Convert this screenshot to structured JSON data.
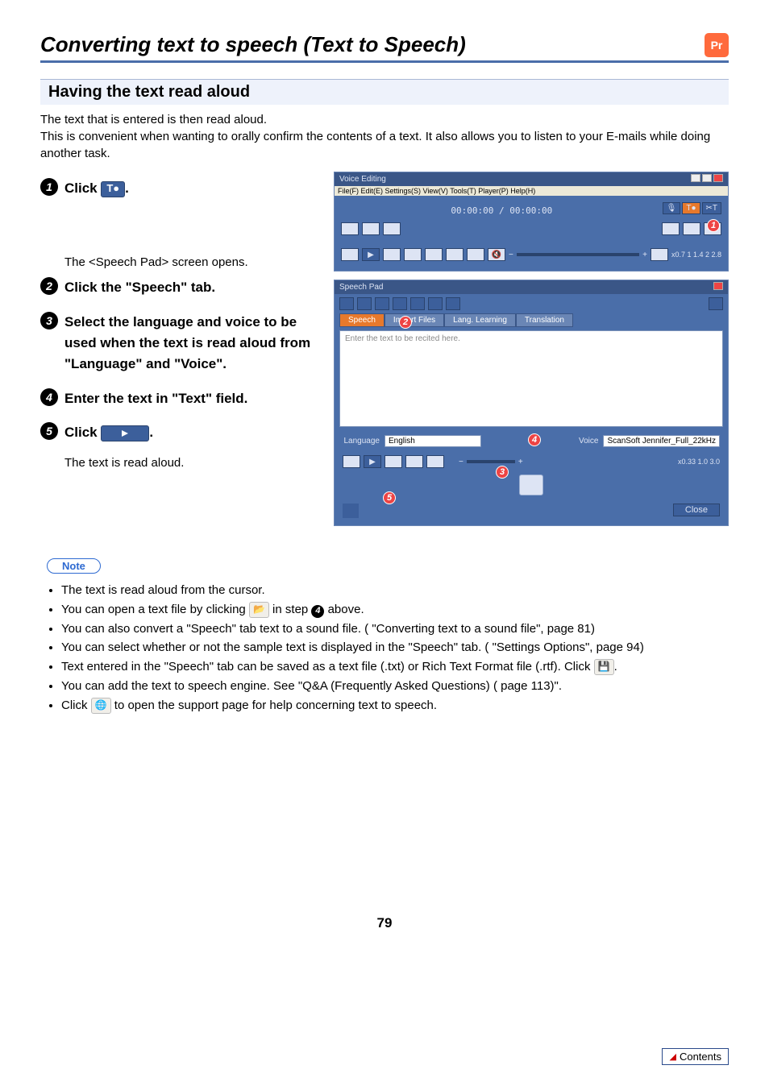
{
  "title": "Converting text to speech (Text to Speech)",
  "badge": "Pr",
  "section": "Having the text read aloud",
  "intro": "The text that is entered is then read aloud.\nThis is convenient when wanting to orally confirm the contents of a text. It also allows you to listen to your E-mails while doing another task.",
  "steps": {
    "s1": {
      "pre": "Click ",
      "chip": "T●",
      "post": "."
    },
    "s1_sub": "The <Speech Pad> screen opens.",
    "s2": "Click the \"Speech\" tab.",
    "s3": "Select the language and voice to be used when the text is read aloud from \"Language\" and \"Voice\".",
    "s4": "Enter the text in \"Text\" field.",
    "s5": {
      "pre": "Click ",
      "post": "."
    },
    "s5_sub": "The text is read aloud."
  },
  "note_label": "Note",
  "notes": {
    "n1": "The text is read aloud from the cursor.",
    "n2a": "You can open a text file by clicking ",
    "n2b": " in step ",
    "n2c": " above.",
    "n3": "You can also convert a \"Speech\" tab text to a sound file. ( \"Converting text to a sound file\", page 81)",
    "n4": "You can select whether or not the sample text is displayed in the \"Speech\" tab. ( \"Settings Options\", page 94)",
    "n5a": "Text entered in the \"Speech\" tab can be saved as a text file (.txt) or Rich Text Format file (.rtf). Click ",
    "n5b": ".",
    "n6": "You can add the text to speech engine. See \"Q&A (Frequently Asked Questions) ( page 113)\".",
    "n7a": "Click ",
    "n7b": " to open the support page for help concerning text to speech."
  },
  "ve": {
    "title": "Voice Editing",
    "menus": "File(F)  Edit(E)  Settings(S)  View(V)  Tools(T)  Player(P)  Help(H)",
    "time": "00:00:00 / 00:00:00",
    "speeds": "x0.7   1   1.4   2   2.8"
  },
  "sp": {
    "title": "Speech Pad",
    "tabs": {
      "speech": "Speech",
      "import": "Import Files",
      "lang": "Lang. Learning",
      "trans": "Translation"
    },
    "placeholder": "Enter the text to be recited here.",
    "language_label": "Language",
    "language_value": "English",
    "voice_label": "Voice",
    "voice_value": "ScanSoft Jennifer_Full_22kHz",
    "speed": "x0.33    1.0    3.0",
    "close": "Close"
  },
  "page": "79",
  "contents": "Contents"
}
